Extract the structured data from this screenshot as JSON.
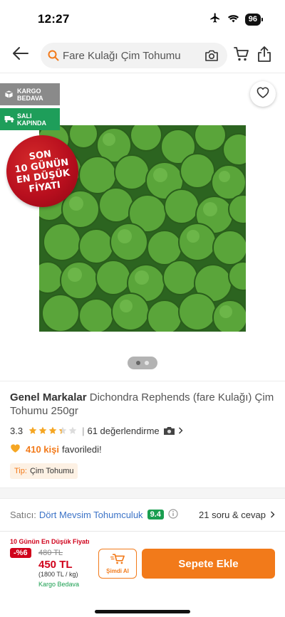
{
  "status_bar": {
    "time": "12:27",
    "battery": "96"
  },
  "search": {
    "query": "Fare Kulağı Çim Tohumu"
  },
  "badges": {
    "cargo_line1": "KARGO",
    "cargo_line2": "BEDAVA",
    "sali_line1": "SALI",
    "sali_line2": "KAPINDA"
  },
  "seal": {
    "line1": "SON",
    "line2": "10 GÜNÜN",
    "line3": "EN DÜŞÜK",
    "line4": "FİYATI"
  },
  "gallery": {
    "pages": 2,
    "active_page": 1
  },
  "product": {
    "brand": "Genel Markalar",
    "name": "Dichondra Rephends (fare Kulağı) Çim Tohumu 250gr",
    "rating": "3.3",
    "rating_value": 3.3,
    "review_count": "61 değerlendirme",
    "fav_count": "410 kişi",
    "fav_text": "favoriledi!",
    "tag_key": "Tip:",
    "tag_value": "Çim Tohumu"
  },
  "seller": {
    "label": "Satıcı:",
    "name": "Dört Mevsim Tohumculuk",
    "score": "9.4",
    "qa": "21 soru & cevap"
  },
  "bottom": {
    "lowest_label": "10 Günün En Düşük Fiyatı",
    "discount": "-%6",
    "old_price": "480 TL",
    "price": "450 TL",
    "unit_price": "(1800 TL / kg)",
    "free_shipping": "Kargo Bedava",
    "buy_now": "Şimdi Al",
    "add_to_cart": "Sepete Ekle"
  },
  "colors": {
    "accent": "#f27a1a",
    "discount_red": "#d0021b",
    "success_green": "#1a9e50",
    "link_blue": "#3c73c7"
  },
  "icons": [
    "back-arrow-icon",
    "search-icon",
    "camera-icon",
    "cart-icon",
    "share-icon",
    "heart-icon",
    "info-icon",
    "chevron-right-icon"
  ]
}
